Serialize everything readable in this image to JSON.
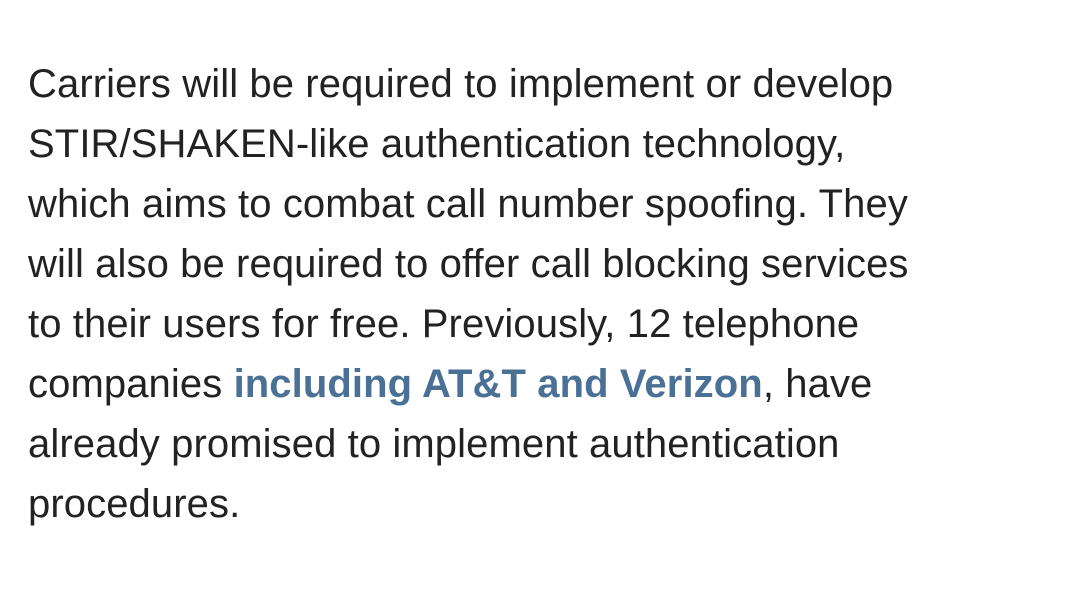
{
  "article": {
    "line1": "Carriers will be required to implement or develop",
    "line2": "STIR/SHAKEN-like authentication technology,",
    "line3": "which aims to combat call number spoofing. They",
    "line4": "will also be required to offer call blocking services",
    "line5": "to their users for free. Previously, 12 telephone",
    "line6_before": "companies ",
    "link_text": "including AT&T and Verizon",
    "line6_after": ", have",
    "line7": "already promised to implement authentication",
    "line8": "procedures."
  },
  "colors": {
    "text": "#222222",
    "link": "#4a7096",
    "background": "#ffffff"
  }
}
